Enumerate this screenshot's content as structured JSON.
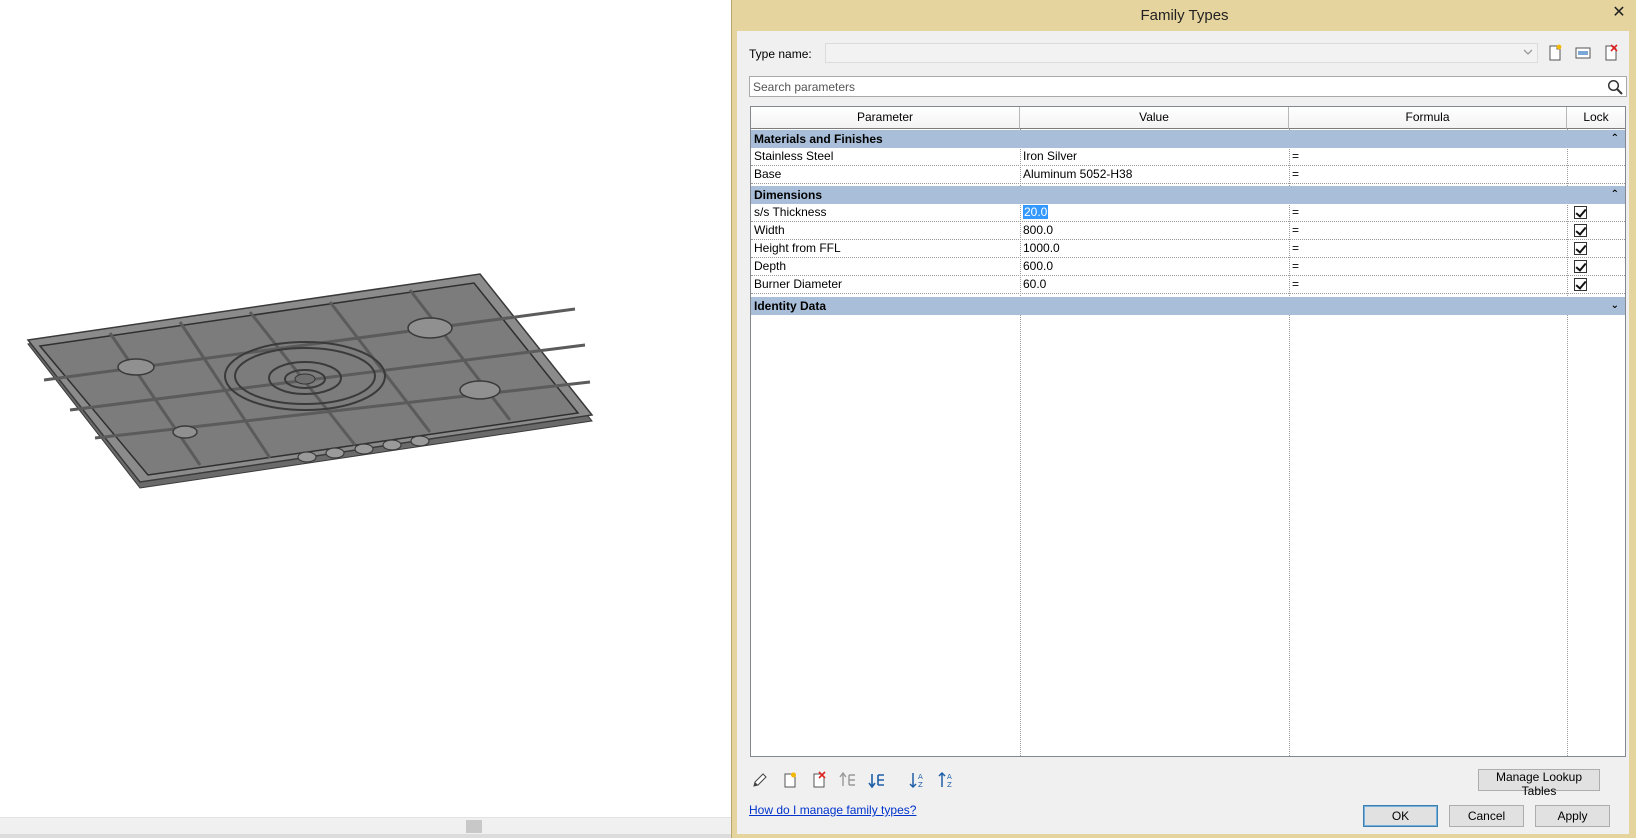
{
  "dialog": {
    "title": "Family Types",
    "close_glyph": "✕",
    "type_name_label": "Type name:",
    "type_name_value": "",
    "search_placeholder": "Search parameters"
  },
  "table": {
    "headers": {
      "parameter": "Parameter",
      "value": "Value",
      "formula": "Formula",
      "lock": "Lock"
    },
    "groups": [
      {
        "name": "Materials and Finishes",
        "chevron": "⌃",
        "rows": [
          {
            "parameter": "Stainless Steel",
            "value": "Iron Silver",
            "formula": "=",
            "lock": null
          },
          {
            "parameter": "Base",
            "value": "Aluminum 5052-H38",
            "formula": "=",
            "lock": null
          }
        ]
      },
      {
        "name": "Dimensions",
        "chevron": "⌃",
        "rows": [
          {
            "parameter": "s/s Thickness",
            "value": "20.0",
            "formula": "=",
            "lock": true,
            "selected": true
          },
          {
            "parameter": "Width",
            "value": "800.0",
            "formula": "=",
            "lock": true
          },
          {
            "parameter": "Height from FFL",
            "value": "1000.0",
            "formula": "=",
            "lock": true
          },
          {
            "parameter": "Depth",
            "value": "600.0",
            "formula": "=",
            "lock": true
          },
          {
            "parameter": "Burner Diameter",
            "value": "60.0",
            "formula": "=",
            "lock": true
          }
        ]
      },
      {
        "name": "Identity Data",
        "chevron": "⌄",
        "rows": []
      }
    ]
  },
  "toolbar_icons": [
    "new-type-icon",
    "rename-type-icon",
    "delete-type-icon"
  ],
  "bottom_tools": [
    "edit-parameter-icon",
    "new-parameter-icon",
    "delete-parameter-icon",
    "move-up-icon",
    "move-down-icon",
    "sort-ascending-icon",
    "sort-descending-icon"
  ],
  "buttons": {
    "manage_lookup": "Manage Lookup Tables",
    "help_link": "How do I manage family types?",
    "ok": "OK",
    "cancel": "Cancel",
    "apply": "Apply"
  },
  "colors": {
    "title_bar": "#e6d49f",
    "group_header": "#a9bfd9",
    "selection": "#3399ff",
    "link": "#0033cc"
  }
}
